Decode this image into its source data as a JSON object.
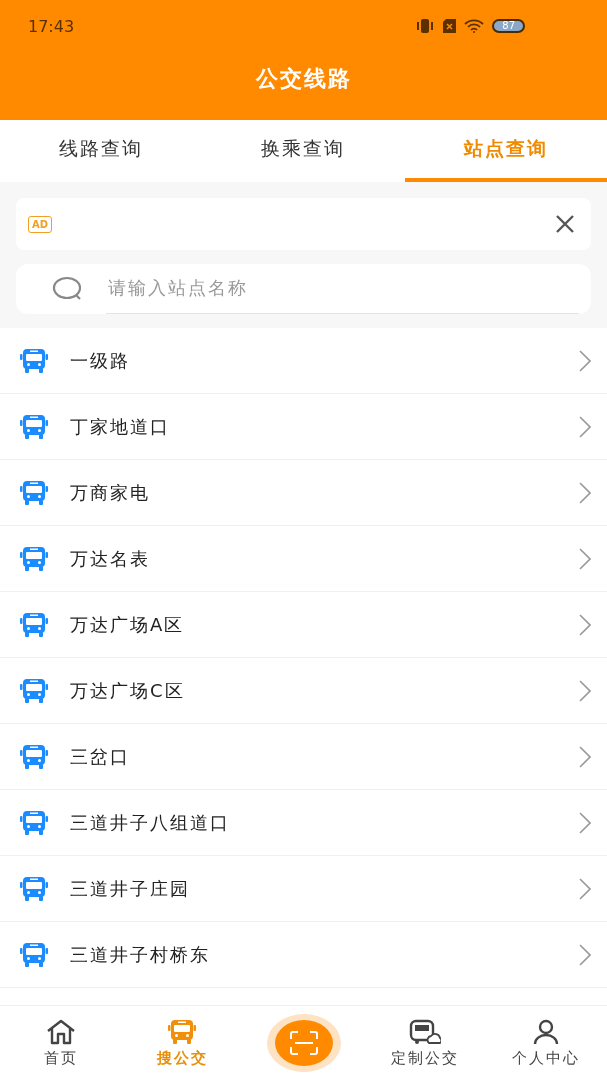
{
  "status_bar": {
    "time": "17:43",
    "battery": "87"
  },
  "header": {
    "title": "公交线路"
  },
  "tabs": [
    {
      "label": "线路查询",
      "selected": false
    },
    {
      "label": "换乘查询",
      "selected": false
    },
    {
      "label": "站点查询",
      "selected": true
    }
  ],
  "ad": {
    "badge": "AD"
  },
  "search": {
    "placeholder": "请输入站点名称"
  },
  "stations": [
    "一级路",
    "丁家地道口",
    "万商家电",
    "万达名表",
    "万达广场A区",
    "万达广场C区",
    "三岔口",
    "三道井子八组道口",
    "三道井子庄园",
    "三道井子村桥东"
  ],
  "nav": [
    {
      "label": "首页",
      "kind": "home",
      "selected": false
    },
    {
      "label": "搜公交",
      "kind": "bus",
      "selected": true
    },
    {
      "label": "定制公交",
      "kind": "custom",
      "selected": false
    },
    {
      "label": "个人中心",
      "kind": "profile",
      "selected": false
    }
  ]
}
